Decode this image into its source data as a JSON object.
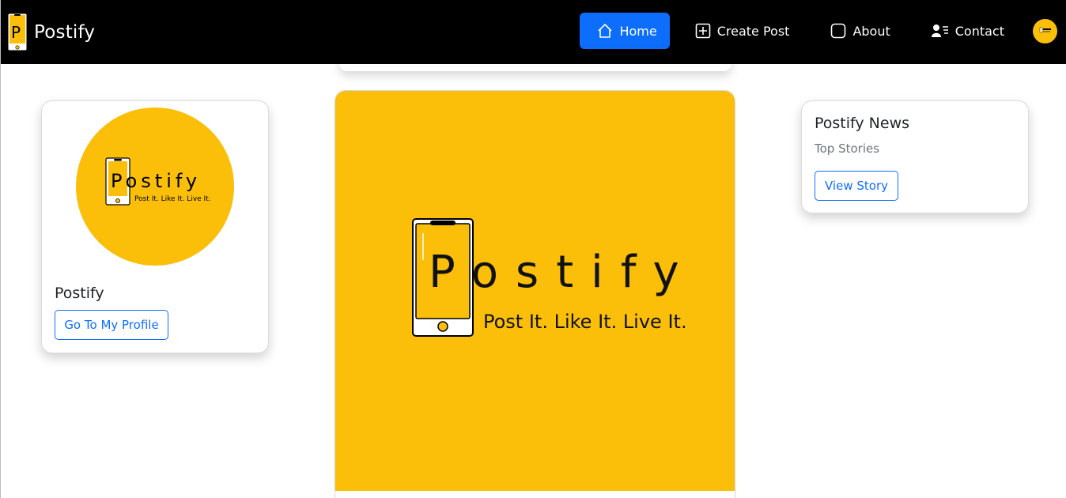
{
  "navbar": {
    "brand": "Postify",
    "items": [
      {
        "label": "Home",
        "icon": "home-icon",
        "active": true
      },
      {
        "label": "Create Post",
        "icon": "plus-square-icon",
        "active": false
      },
      {
        "label": "About",
        "icon": "square-icon",
        "active": false
      },
      {
        "label": "Contact",
        "icon": "person-lines-icon",
        "active": false
      }
    ]
  },
  "profile": {
    "name": "Postify",
    "button": "Go To My Profile",
    "logo_text": "Postify",
    "logo_letter": "P",
    "logo_rest": "ostify",
    "tagline": "Post It. Like It. Live It."
  },
  "post": {
    "logo_letter": "P",
    "logo_rest": "ostify",
    "tagline": "Post It. Like It. Live It."
  },
  "news": {
    "title": "Postify News",
    "subtitle": "Top Stories",
    "button": "View Story"
  },
  "colors": {
    "navbar_bg": "#000000",
    "brand_yellow": "#fbbf09",
    "primary": "#0d6efd"
  }
}
